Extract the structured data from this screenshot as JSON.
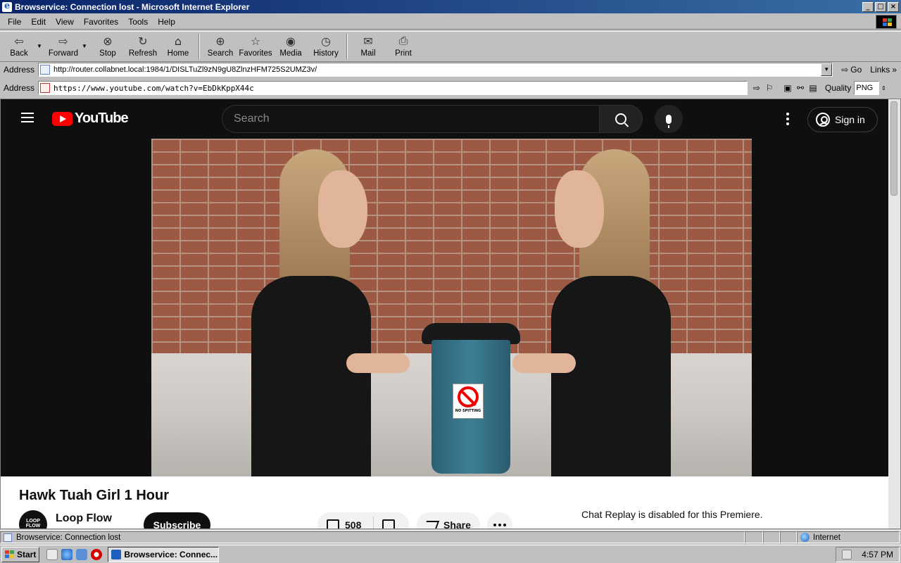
{
  "window": {
    "title": "Browservice: Connection lost - Microsoft Internet Explorer",
    "controls": [
      "_",
      "□",
      "×"
    ]
  },
  "menu": [
    "File",
    "Edit",
    "View",
    "Favorites",
    "Tools",
    "Help"
  ],
  "toolbar": {
    "back": "Back",
    "forward": "Forward",
    "stop": "Stop",
    "refresh": "Refresh",
    "home": "Home",
    "search": "Search",
    "favorites": "Favorites",
    "media": "Media",
    "history": "History",
    "mail": "Mail",
    "print": "Print"
  },
  "ie_address": {
    "label": "Address",
    "url": "http://router.collabnet.local:1984/1/DISLTuZl9zN9gU8ZlnzHFM725S2UMZ3v/",
    "go": "Go",
    "links": "Links"
  },
  "bs_address": {
    "label": "Address",
    "url": "https://www.youtube.com/watch?v=EbDkKppX44c",
    "quality_label": "Quality",
    "quality_value": "PNG"
  },
  "youtube": {
    "logo_text": "YouTube",
    "search_placeholder": "Search",
    "sign_in": "Sign in",
    "video_title": "Hawk Tuah Girl 1 Hour",
    "channel_name": "Loop Flow",
    "channel_avatar_text": "LOOP FLOW",
    "subscribe": "Subscribe",
    "likes": "508",
    "share": "Share",
    "chat_replay": "Chat Replay is disabled for this Premiere.",
    "sign_text": "NO SPITTING"
  },
  "statusbar": {
    "text": "Browservice: Connection lost",
    "zone": "Internet"
  },
  "taskbar": {
    "start": "Start",
    "task": "Browservice: Connec...",
    "time": "4:57 PM"
  },
  "colors": {
    "titlebar_start": "#0a246a",
    "titlebar_end": "#3a6ea5",
    "yt_red": "#ff0000",
    "yt_bg": "#0f0f0f"
  }
}
